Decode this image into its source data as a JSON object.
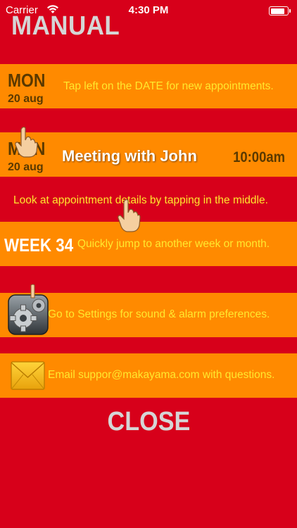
{
  "status_bar": {
    "carrier": "Carrier",
    "time": "4:30 PM",
    "battery_level": 0.9
  },
  "title": "MANUAL",
  "rows": {
    "new_appointment": {
      "day": "MON",
      "date": "20 aug",
      "hint": "Tap left on the DATE for new appointments."
    },
    "appointment": {
      "day": "MON",
      "date": "20 aug",
      "meeting_title": "Meeting with John",
      "meeting_time": "10:00am"
    },
    "details_hint": "Look at appointment details by tapping in the middle.",
    "week": {
      "label": "WEEK 34",
      "hint": "Quickly jump to another week or month."
    },
    "settings": {
      "hint": "Go to Settings for sound & alarm preferences.",
      "icon": "gear-icon"
    },
    "email": {
      "hint": "Email suppor@makayama.com with questions.",
      "icon": "envelope-icon"
    }
  },
  "close_label": "CLOSE",
  "colors": {
    "background": "#D7001A",
    "band": "#FF8A00",
    "hint_text": "#FFE82E",
    "date_text": "#5A3900",
    "title_text": "#D5D5D5"
  }
}
